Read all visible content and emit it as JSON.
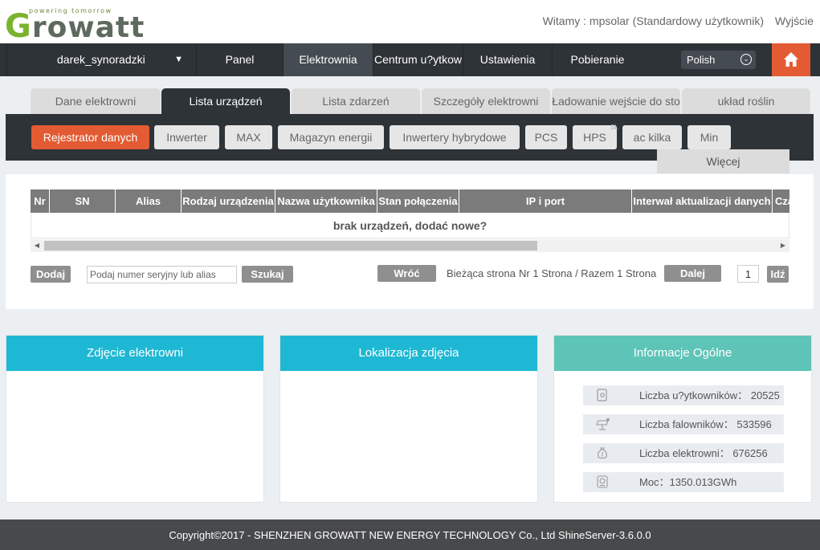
{
  "header": {
    "logo_tagline": "powering tomorrow",
    "logo_g": "G",
    "logo_rest": "rowatt",
    "welcome": "Witamy : mpsolar (Standardowy użytkownik)",
    "logout": "Wyjście"
  },
  "nav": {
    "user": "darek_synoradzki",
    "caret": "▼",
    "items": [
      "Panel",
      "Elektrownia",
      "Centrum u?ytkow",
      "Ustawienia",
      "Pobieranie"
    ],
    "active_index": 1,
    "language": "Polish",
    "language_chevron": "⌄"
  },
  "tabs": [
    "Dane elektrowni",
    "Lista urządzeń",
    "Lista zdarzeń",
    "Szczegóły elektrowni",
    "Ładowanie wejście do sto",
    "układ roślin"
  ],
  "device_types": [
    "Rejestrator danych",
    "Inwerter",
    "MAX",
    "Magazyn energii",
    "Inwertery hybrydowe",
    "PCS",
    "HPS",
    "ac kilka",
    "Min"
  ],
  "device_sup": "SL",
  "more": "Więcej",
  "table": {
    "columns": [
      "Nr",
      "SN",
      "Alias",
      "Rodzaj urządzenia",
      "Nazwa użytkownika",
      "Stan połączenia",
      "IP i port",
      "Interwał aktualizacji danych",
      "Cza"
    ],
    "empty_message": "brak urządzeń, dodać nowe?"
  },
  "actions": {
    "add": "Dodaj",
    "search_placeholder": "Podaj numer seryjny lub alias",
    "search": "Szukaj",
    "back": "Wróć",
    "current_page_label": "Bieżąca strona",
    "page_info": "Nr 1 Strona / Razem 1 Strona",
    "next": "Dalej",
    "page_value": "1",
    "goto": "Idź"
  },
  "cards": {
    "photo_title": "Zdjęcie elektrowni",
    "location_title": "Lokalizacja zdjęcia",
    "info_title": "Informacje Ogólne",
    "info": [
      {
        "icon": "user-icon",
        "text": "Liczba u?ytkowników： 20525"
      },
      {
        "icon": "inverter-icon",
        "text": "Liczba falowników： 533596"
      },
      {
        "icon": "money-bag-icon",
        "text": "Liczba elektrowni： 676256"
      },
      {
        "icon": "power-meter-icon",
        "text": "Moc：1350.013GWh"
      }
    ]
  },
  "footer": "Copyright©2017 - SHENZHEN GROWATT NEW ENERGY TECHNOLOGY Co., Ltd ShineServer-3.6.0.0",
  "colors": {
    "nav_bg": "#2e3338",
    "accent_orange": "#e35b33",
    "card_blue": "#1fb8d4",
    "card_green": "#5ec4b7",
    "logo_green": "#7bb32e"
  }
}
